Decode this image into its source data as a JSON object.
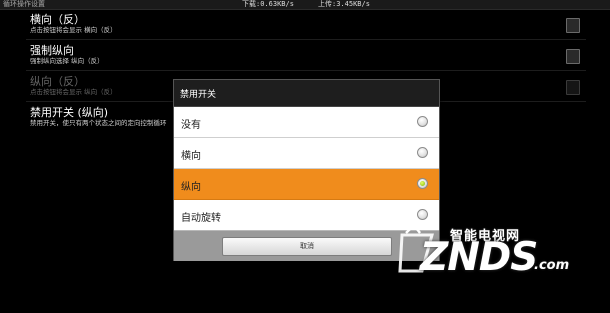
{
  "status_bar": {
    "app_title": "循环操作设置",
    "download": "下载:0.63KB/s",
    "upload": "上传:3.45KB/s"
  },
  "preferences": [
    {
      "title": "横向（反）",
      "summary": "点击按钮将会显示 横向（反）",
      "checked": false,
      "enabled": true
    },
    {
      "title": "强制纵向",
      "summary": "强制纵向选择 纵向（反）",
      "checked": false,
      "enabled": true
    },
    {
      "title": "纵向（反）",
      "summary": "点击按钮将会显示 纵向（反）",
      "checked": false,
      "enabled": false
    },
    {
      "title": "禁用开关 (纵向)",
      "summary": "禁用开关，使只有两个状态之间的定向控制循环",
      "enabled": true
    }
  ],
  "dialog": {
    "title": "禁用开关",
    "options": [
      {
        "label": "没有",
        "selected": false
      },
      {
        "label": "横向",
        "selected": false
      },
      {
        "label": "纵向",
        "selected": true
      },
      {
        "label": "自动旋转",
        "selected": false
      }
    ],
    "cancel_label": "取消"
  },
  "watermark": {
    "chinese": "智能电视网",
    "brand": "ZNDS",
    "suffix": ".com"
  },
  "colors": {
    "selected_option": "#f08c1c",
    "background": "#000000",
    "dialog_footer": "#9a9a9a"
  }
}
